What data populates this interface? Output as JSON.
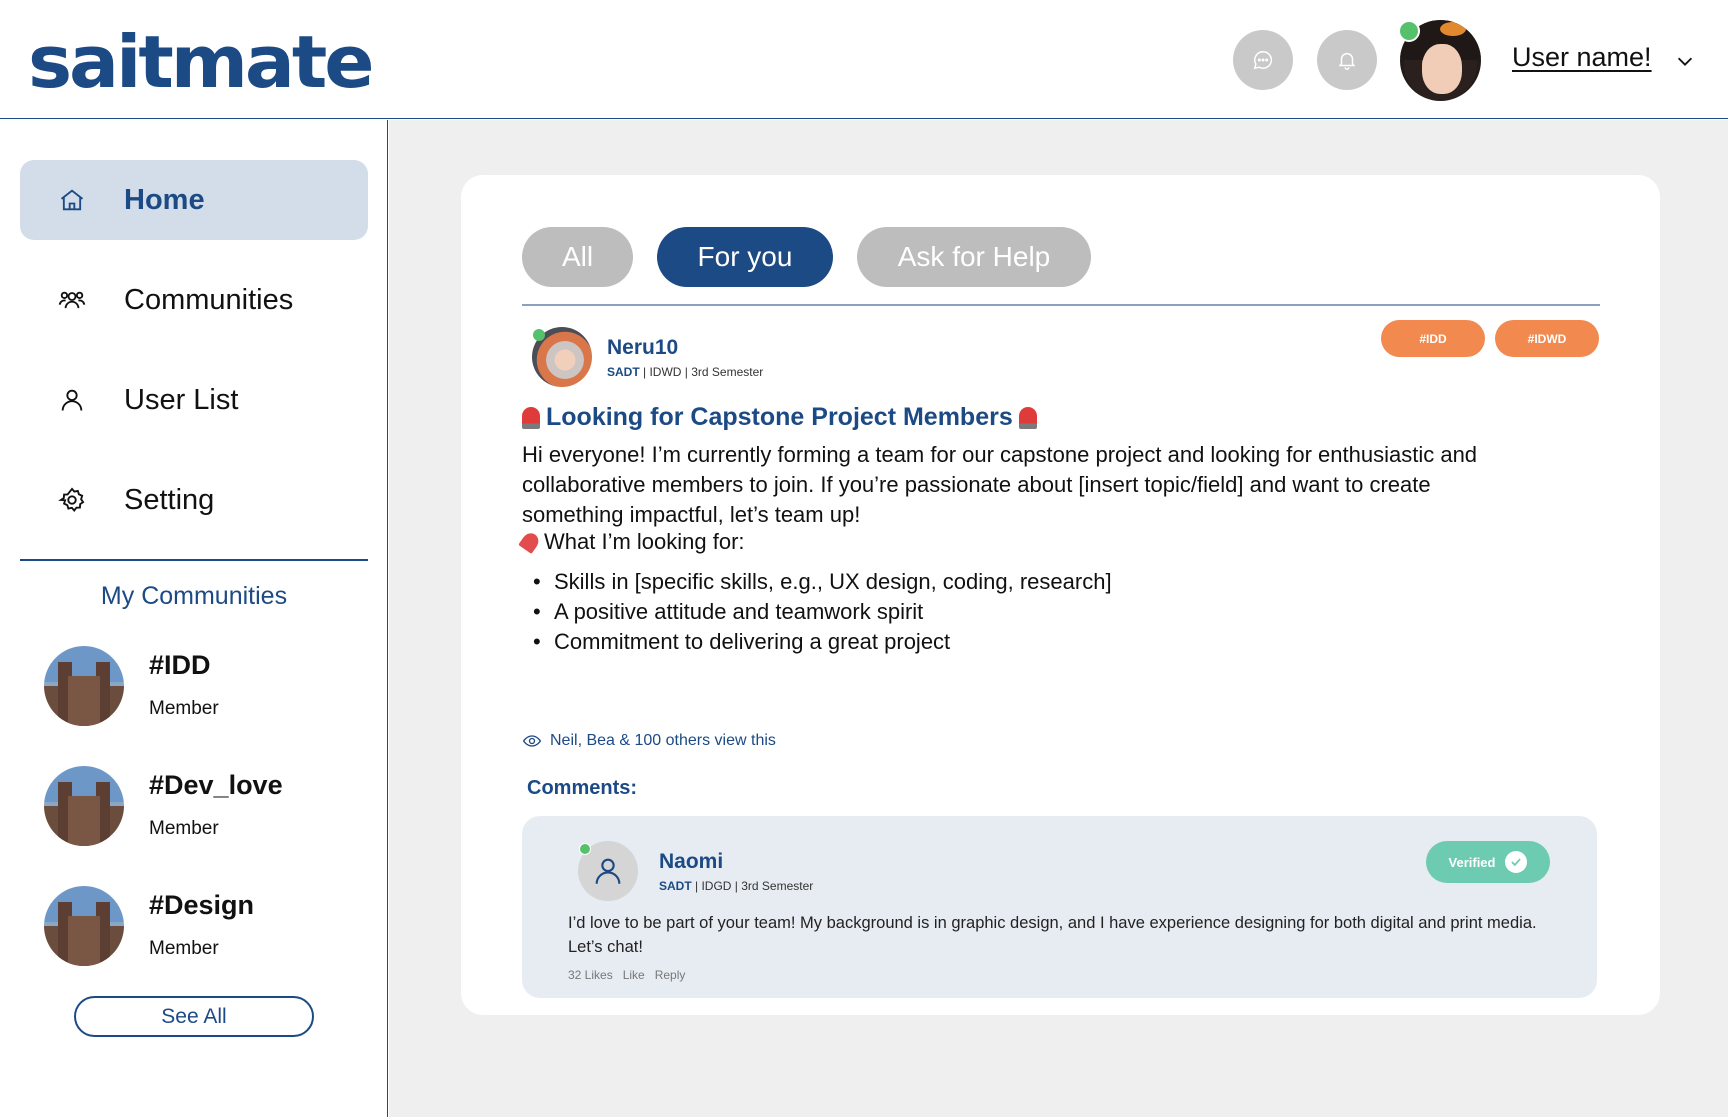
{
  "app": {
    "logo_text": "saitmate",
    "user_name": "User name!"
  },
  "sidebar": {
    "nav": [
      {
        "label": "Home",
        "icon": "home-icon",
        "active": true
      },
      {
        "label": "Communities",
        "icon": "people-icon",
        "active": false
      },
      {
        "label": "User List",
        "icon": "user-icon",
        "active": false
      },
      {
        "label": "Setting",
        "icon": "gear-icon",
        "active": false
      }
    ],
    "my_communities_title": "My Communities",
    "communities": [
      {
        "name": "#IDD",
        "role": "Member"
      },
      {
        "name": "#Dev_love",
        "role": "Member"
      },
      {
        "name": "#Design",
        "role": "Member"
      }
    ],
    "see_all_label": "See All"
  },
  "feed": {
    "tabs": [
      {
        "label": "All",
        "active": false
      },
      {
        "label": "For you",
        "active": true
      },
      {
        "label": "Ask for Help",
        "active": false
      }
    ],
    "post": {
      "author": "Neru10",
      "meta_school": "SADT",
      "meta_rest": " | IDWD | 3rd Semester",
      "tags": [
        "#IDD",
        "#IDWD"
      ],
      "title": "Looking for Capstone Project Members",
      "body": "Hi everyone! I’m currently forming a team for our capstone project and looking for enthusiastic and collaborative members to join. If you’re passionate about [insert topic/field] and want to create something impactful, let’s team up!",
      "looking_for": "What I’m looking for:",
      "bullets": [
        "Skills in [specific skills, e.g., UX design, coding, research]",
        "A positive attitude and teamwork spirit",
        "Commitment to delivering a great project"
      ],
      "views_text": "Neil, Bea & 100 others view this"
    },
    "comments_title": "Comments:",
    "comment": {
      "name": "Naomi",
      "meta_school": "SADT",
      "meta_rest": " | IDGD | 3rd Semester",
      "badge": "Verified",
      "text": "I’d love to be part of your team! My background is in graphic design, and I have experience designing for both digital and print media. Let’s chat!",
      "likes": "32 Likes",
      "like_label": "Like",
      "reply_label": "Reply"
    }
  },
  "colors": {
    "brand": "#1c4a85",
    "tag": "#f2894e",
    "verified": "#6ccbb1",
    "online": "#55c26b"
  }
}
